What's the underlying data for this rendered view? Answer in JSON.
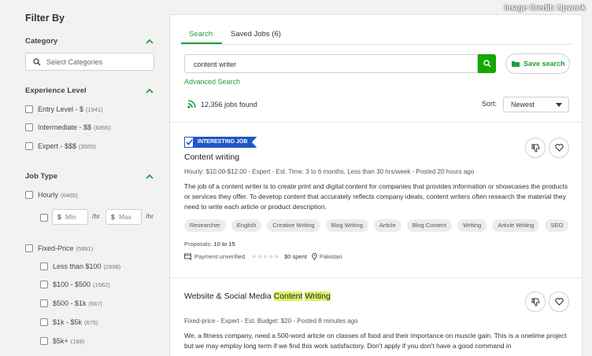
{
  "credit": "Image Credit: Upwork",
  "sidebar": {
    "title": "Filter By",
    "category": {
      "heading": "Category",
      "placeholder": "Select Categories"
    },
    "experience": {
      "heading": "Experience Level",
      "options": [
        {
          "label": "Entry Level - $",
          "count": "(1941)"
        },
        {
          "label": "Intermediate - $$",
          "count": "(6856)"
        },
        {
          "label": "Expert - $$$",
          "count": "(3555)"
        }
      ]
    },
    "job_type": {
      "heading": "Job Type",
      "hourly": {
        "label": "Hourly",
        "count": "(6465)"
      },
      "min": {
        "currency": "$",
        "placeholder": "Min"
      },
      "max": {
        "currency": "$",
        "placeholder": "Max"
      },
      "per_hr": "/hr",
      "fixed": {
        "label": "Fixed-Price",
        "count": "(5891)"
      },
      "fixed_options": [
        {
          "label": "Less than $100",
          "count": "(2698)"
        },
        {
          "label": "$100 - $500",
          "count": "(1662)"
        },
        {
          "label": "$500 - $1k",
          "count": "(667)"
        },
        {
          "label": "$1k - $5k",
          "count": "(675)"
        },
        {
          "label": "$5k+",
          "count": "(189)"
        }
      ]
    }
  },
  "main": {
    "tabs": [
      {
        "label": "Search"
      },
      {
        "label": "Saved Jobs (6)"
      }
    ],
    "search_value": "content writer",
    "save_search": "Save search",
    "advanced": "Advanced Search",
    "found_count": "12,356",
    "found_suffix": "jobs found",
    "sort_label": "Sort:",
    "sort_value": "Newest"
  },
  "jobs": [
    {
      "badge": "INTERESTING JOB",
      "title": "Content writing",
      "meta": "Hourly: $10.00-$12.00 - Expert - Est. Time: 3 to 6 months, Less than 30 hrs/week - Posted 20 hours ago",
      "description": "The job of a content writer is to create print and digital content for companies that provides information or showcases the products or services they offer. To develop content that accurately reflects company ideals, content writers often research the material they need to write each article or product description.",
      "tags": [
        "Researcher",
        "English",
        "Creative Writing",
        "Blog Writing",
        "Article",
        "Blog Content",
        "Writing",
        "Article Writing",
        "SEO"
      ],
      "proposals_label": "Proposals:",
      "proposals_value": "10 to 15",
      "payment": "Payment unverified",
      "spent": "$0 spent",
      "location": "Pakistan"
    },
    {
      "title_prefix": "Website & Social Media ",
      "title_hl1": "Content",
      "title_hl2": "Writing",
      "meta": "Fixed-price - Expert - Est. Budget: $20 - Posted 8 minutes ago",
      "description": "We, a fitness company, need a 500-word article on classes of food and their importance on muscle gain. This is a onetime project but we may employ long term if we find this work satisfactory. Don't apply if you don't have a good command in"
    }
  ],
  "colors": {
    "accent": "#14a800",
    "badge": "#1f57c3",
    "highlight": "#d8f26a"
  }
}
